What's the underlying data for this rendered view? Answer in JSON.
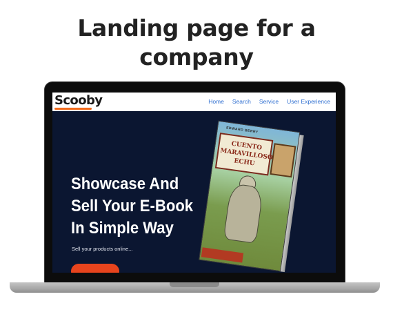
{
  "headline": {
    "line1": "Landing page for a",
    "line2": "company"
  },
  "site": {
    "logo": "Scooby",
    "nav": {
      "home": "Home",
      "search": "Search",
      "service": "Service",
      "user_experience": "User Experience"
    },
    "hero": {
      "title_line1": "Showcase And",
      "title_line2": "Sell Your E-Book",
      "title_line3": "In Simple Way",
      "subtitle": "Sell your products online..."
    },
    "book": {
      "author": "EDWARD BERRY",
      "title_line1": "CUENTO",
      "title_line2": "MARAVILLOSO",
      "title_line3": "ECHU"
    }
  },
  "colors": {
    "accent": "#e8441d",
    "hero_bg": "#0b1631",
    "nav_link": "#2f6fd1"
  }
}
